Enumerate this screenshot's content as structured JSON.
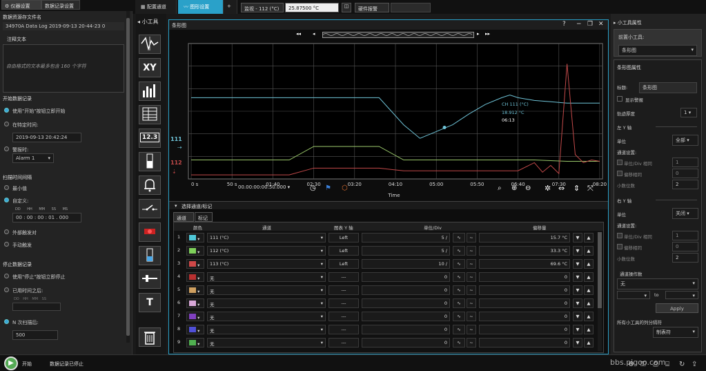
{
  "top": {
    "left_tabs": [
      "仪器设置",
      "数据记录设置"
    ],
    "center_tabs": [
      "配置通道",
      "图形设置"
    ],
    "add_tab": "+",
    "monitor_label": "监视 - 112 (°C)",
    "monitor_value": "25.87500 °C",
    "hw_alarm": "硬件报警"
  },
  "left": {
    "file_label": "数据资源存文件名",
    "file_name": "34970A Data Log 2019-09-13 20-44-23 0",
    "note_label": "注释文本",
    "note_placeholder": "自由格式的文本最多包含 160 个字符",
    "start_title": "开始数据记录",
    "start_opt1": "使用\"开始\"按钮立即开始",
    "start_opt2": "在特定时间:",
    "start_time": "2019-09-13 20:42:24",
    "start_opt3": "警报时:",
    "alarm_value": "Alarm 1",
    "scan_title": "扫描时间间隔",
    "scan_opt1": "最小值",
    "scan_opt2": "自定义:",
    "interval_head": [
      "DD",
      "HH",
      "MM",
      "SS",
      "MS"
    ],
    "interval_value": "00 : 00 : 00 : 01 . 000",
    "scan_opt3": "外部触发对",
    "scan_opt4": "手动触发",
    "stop_title": "停止数据记录",
    "stop_opt1": "使用\"停止\"按钮立即停止",
    "stop_opt2": "已用时间之后:",
    "stop_head": [
      "DD",
      "HH",
      "MM",
      "SS"
    ],
    "stop_opt3": "N 次扫描后:",
    "scan_count": "500"
  },
  "tools": {
    "title": "小工具",
    "xy": "XY",
    "digital": "12.3",
    "text": "T"
  },
  "chart": {
    "panel_title": "条形图",
    "time_window": "00.00:00:00:50.000",
    "marker_label": "CH 111 (°C)",
    "marker_value": "18.912 °C",
    "marker_time": "06:13",
    "left_tag_1": "111",
    "left_tag_2": "112",
    "xaxis_title": "Time",
    "ctrl_title": "选择通道/标记"
  },
  "chart_data": {
    "type": "line",
    "x_ticks": [
      "0 s",
      "50 s",
      "01:40",
      "02:30",
      "03:20",
      "04:10",
      "05:00",
      "05:50",
      "06:40",
      "07:30",
      "08:20"
    ],
    "xlabel": "Time",
    "series": [
      {
        "name": "111 (°C)",
        "color": "#6fc4d8",
        "x": [
          0,
          60,
          120,
          150,
          180,
          230,
          260,
          280,
          300,
          320,
          340,
          360,
          380,
          390,
          400,
          420,
          440,
          460,
          500
        ],
        "y": [
          60,
          60,
          60,
          60,
          60,
          60,
          40,
          30,
          35,
          40,
          48,
          55,
          60,
          62,
          60,
          58,
          57,
          56,
          56
        ]
      },
      {
        "name": "112 (°C)",
        "color": "#9bc96b",
        "x": [
          0,
          60,
          120,
          150,
          180,
          230,
          260,
          280,
          300,
          320,
          340,
          360,
          380,
          420,
          460,
          500
        ],
        "y": [
          14,
          14,
          14,
          24,
          24,
          24,
          14,
          14,
          14,
          14,
          14,
          14,
          14,
          14,
          13,
          13
        ]
      },
      {
        "name": "113 (°C)",
        "color": "#c44a4a",
        "x": [
          0,
          60,
          120,
          150,
          180,
          230,
          260,
          300,
          340,
          390,
          400,
          420,
          430,
          440,
          450,
          460,
          470,
          480,
          490,
          500
        ],
        "y": [
          3,
          3,
          3,
          8,
          8,
          8,
          6,
          6,
          6,
          6,
          6,
          12,
          5,
          10,
          4,
          85,
          18,
          12,
          14,
          13
        ]
      }
    ],
    "xlim": [
      0,
      500
    ],
    "ylim": [
      0,
      100
    ]
  },
  "table": {
    "tabs": [
      "通道数",
      "标记"
    ],
    "headers": [
      "颜色",
      "通道",
      "图表 Y 轴",
      "单位/Div",
      "偏移量"
    ],
    "rows": [
      {
        "n": "1",
        "color": "#4fc8d8",
        "ch": "111 (°C)",
        "axis": "Left",
        "div": "5 /",
        "off": "15.7 °C"
      },
      {
        "n": "2",
        "color": "#7ed05a",
        "ch": "112 (°C)",
        "axis": "Left",
        "div": "5 /",
        "off": "33.3 °C"
      },
      {
        "n": "3",
        "color": "#d04848",
        "ch": "113 (°C)",
        "axis": "Left",
        "div": "10 /",
        "off": "69.6 °C"
      },
      {
        "n": "4",
        "color": "#b83030",
        "ch": "无",
        "axis": "---",
        "div": "0",
        "off": "0"
      },
      {
        "n": "5",
        "color": "#d0a060",
        "ch": "无",
        "axis": "---",
        "div": "0",
        "off": "0"
      },
      {
        "n": "6",
        "color": "#d8a8d8",
        "ch": "无",
        "axis": "---",
        "div": "0",
        "off": "0"
      },
      {
        "n": "7",
        "color": "#8040c0",
        "ch": "无",
        "axis": "---",
        "div": "0",
        "off": "0"
      },
      {
        "n": "8",
        "color": "#5050d8",
        "ch": "无",
        "axis": "---",
        "div": "0",
        "off": "0"
      },
      {
        "n": "9",
        "color": "#50b050",
        "ch": "无",
        "axis": "---",
        "div": "0",
        "off": "0"
      }
    ]
  },
  "right": {
    "title": "小工具属性",
    "front_label": "前置小工具:",
    "front_value": "条形图",
    "props_title": "条形图属性",
    "label_title": "标题:",
    "title_value": "条形图",
    "show_alarm": "显示警报",
    "trace_thick": "轨迹厚度",
    "trace_value": "1",
    "left_y": "左 Y 轴",
    "unit_label": "单位",
    "unit_left": "全部",
    "ch_settings": "通道设置:",
    "unit_div_same": "单位/Div 相同",
    "offset_same": "偏移相同",
    "decimals": "小数位数",
    "val1": "1",
    "val0": "0",
    "val2": "2",
    "right_y": "右 Y 轴",
    "unit_right": "关闭",
    "ops_title": "通道操作数",
    "ops_value": "无",
    "to": "to",
    "apply": "Apply",
    "delimiter_label": "所有小工具的列分隔符",
    "delimiter_value": "制表符"
  },
  "footer": {
    "start": "开始",
    "status": "数据记录已停止"
  },
  "watermark": "bbs.pigoo.com"
}
